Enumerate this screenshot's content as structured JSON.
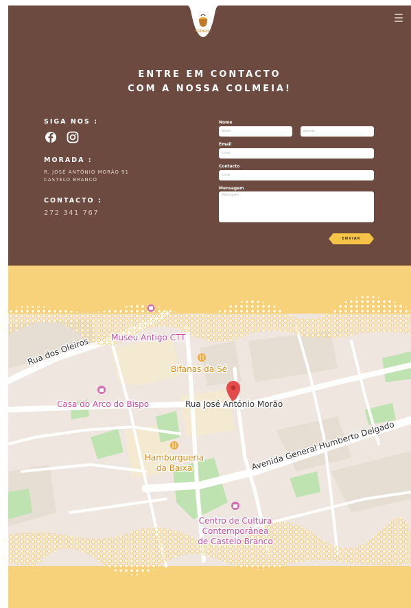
{
  "contact": {
    "heading_line1": "ENTRE EM CONTACTO",
    "heading_line2": "COM A NOSSA COLMEIA!",
    "follow_label": "SIGA NOS :",
    "address_label": "MORADA :",
    "address_line1": "R. JOSÉ ANTÓNIO MORÃO 91",
    "address_line2": "CASTELO BRANCO",
    "contact_label": "CONTACTO :",
    "phone": "272 341 767",
    "logo_text": "Colmeia",
    "colors": {
      "background": "#6c4a3f",
      "accent": "#f5c447"
    }
  },
  "form": {
    "name_label": "Nome",
    "first_name_placeholder": "Nome",
    "last_name_placeholder": "Apelido",
    "email_label": "Email",
    "email_placeholder": "Email",
    "phone_label": "Contacto",
    "phone_placeholder": "Email",
    "message_label": "Mensagem",
    "message_placeholder": "Mensagem",
    "submit_label": "ENVIAR"
  },
  "map": {
    "background": "#f7d27b",
    "labels": {
      "oleiros": "Rua dos Oleiros",
      "museum": "Museu Antigo CTT",
      "bifanas": "Bifanas da Sé",
      "casa": "Casa do Arco do Bispo",
      "street": "Rua José António Morão",
      "avenida": "Avenida General Humberto Delgado",
      "hamb1": "Hamburgueria",
      "hamb2": "da Baixa",
      "centro1": "Centro de Cultura",
      "centro2": "Contemporânea",
      "centro3": "de Castelo Branco"
    }
  }
}
